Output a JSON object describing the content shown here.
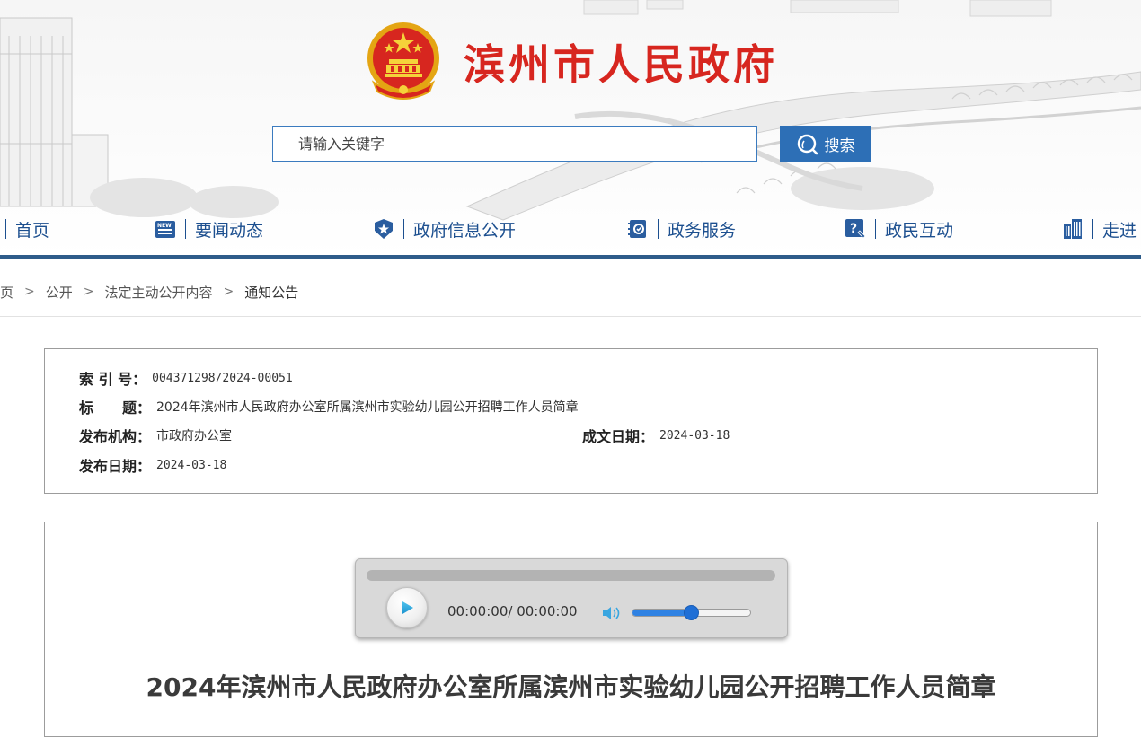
{
  "site": {
    "title": "滨州市人民政府"
  },
  "search": {
    "placeholder": "请输入关键字",
    "button_label": "搜索"
  },
  "nav": {
    "items": [
      {
        "label": "首页",
        "icon": "home-icon"
      },
      {
        "label": "要闻动态",
        "icon": "news-icon"
      },
      {
        "label": "政府信息公开",
        "icon": "badge-icon"
      },
      {
        "label": "政务服务",
        "icon": "service-icon"
      },
      {
        "label": "政民互动",
        "icon": "interaction-icon"
      },
      {
        "label": "走进",
        "icon": "building-icon"
      }
    ]
  },
  "breadcrumb": {
    "items": [
      "页",
      "公开",
      "法定主动公开内容",
      "通知公告"
    ],
    "separator": ">"
  },
  "meta": {
    "index_label": "索 引 号：",
    "index_value": "004371298/2024-00051",
    "title_label": "标　　题：",
    "title_value": "2024年滨州市人民政府办公室所属滨州市实验幼儿园公开招聘工作人员简章",
    "publisher_label": "发布机构：",
    "publisher_value": "市政府办公室",
    "created_label": "成文日期：",
    "created_value": "2024-03-18",
    "published_label": "发布日期：",
    "published_value": "2024-03-18"
  },
  "player": {
    "time": "00:00:00/ 00:00:00",
    "volume": 0.5,
    "progress": 0
  },
  "article": {
    "title": "2024年滨州市人民政府办公室所属滨州市实验幼儿园公开招聘工作人员简章"
  },
  "colors": {
    "brand_red": "#d7261f",
    "nav_blue": "#1c4f8f",
    "button_blue": "#2d6fb6",
    "volume_blue": "#2f82e3"
  }
}
